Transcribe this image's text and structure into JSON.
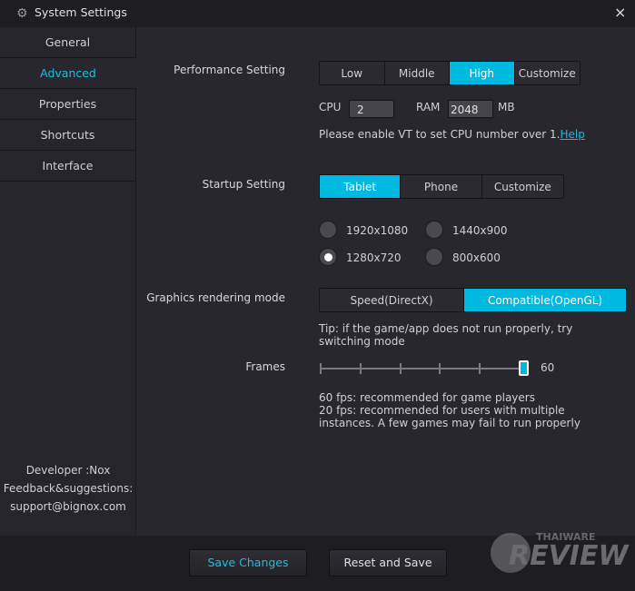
{
  "window": {
    "title": "System Settings",
    "icon": "gear-icon",
    "close": "×"
  },
  "sidebar": {
    "items": [
      {
        "label": "General"
      },
      {
        "label": "Advanced"
      },
      {
        "label": "Properties"
      },
      {
        "label": "Shortcuts"
      },
      {
        "label": "Interface"
      }
    ],
    "selected": "Advanced",
    "developer": "Developer :Nox",
    "feedback": "Feedback&suggestions:",
    "email": "support@bignox.com"
  },
  "performance": {
    "label": "Performance Setting",
    "options": [
      "Low",
      "Middle",
      "High",
      "Customize"
    ],
    "selected": "High",
    "cpu_label": "CPU",
    "cpu_value": "2",
    "ram_label": "RAM",
    "ram_value": "2048",
    "ram_unit": "MB",
    "vt_note": "Please enable VT to set CPU number over 1.",
    "help_link": "Help"
  },
  "startup": {
    "label": "Startup Setting",
    "options": [
      "Tablet",
      "Phone",
      "Customize"
    ],
    "selected": "Tablet",
    "resolutions": [
      "1920x1080",
      "1440x900",
      "1280x720",
      "800x600"
    ],
    "selected_resolution": "1280x720"
  },
  "graphics": {
    "label": "Graphics rendering mode",
    "options": [
      "Speed(DirectX)",
      "Compatible(OpenGL)"
    ],
    "selected": "Compatible(OpenGL)",
    "tip": "Tip: if the game/app does not run properly, try switching mode"
  },
  "frames": {
    "label": "Frames",
    "value": "60",
    "slider_fraction": 1.0,
    "note1": "60 fps: recommended for game players",
    "note2": "20 fps: recommended for users with multiple instances. A few games may fail to run properly"
  },
  "footer": {
    "save": "Save Changes",
    "reset": "Reset and Save"
  },
  "watermark": {
    "text1": "THAIWARE",
    "text2": "REVIEW"
  },
  "colors": {
    "accent": "#00b9e1"
  }
}
